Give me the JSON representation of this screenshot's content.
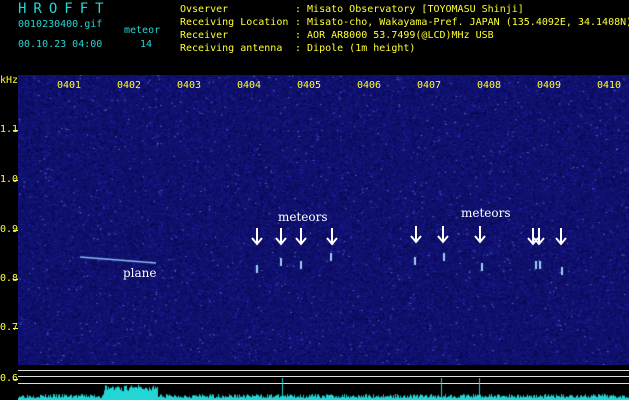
{
  "header": {
    "logo": "HROFFT",
    "filename": "0010230400.gif",
    "type_label": "meteor",
    "datetime": "00.10.23 04:00",
    "count": "14",
    "rows": [
      {
        "label": "Ovserver",
        "value": ": Misato Observatory [TOYOMASU Shinji]"
      },
      {
        "label": "Receiving Location",
        "value": ": Misato-cho, Wakayama-Pref. JAPAN (135.4092E, 34.1408N)"
      },
      {
        "label": "Receiver",
        "value": ": AOR AR8000 53.7499(@LCD)MHz USB"
      },
      {
        "label": "Receiving antenna",
        "value": ": Dipole (1m height)"
      }
    ]
  },
  "axis": {
    "unit": "kHz",
    "y_labels": [
      "1.1",
      "1.0",
      "0.9",
      "0.8",
      "0.7",
      "0.6"
    ],
    "time_labels": [
      "0401",
      "0402",
      "0403",
      "0404",
      "0405",
      "0406",
      "0407",
      "0408",
      "0409",
      "0410"
    ]
  },
  "annotations": {
    "meteors_left": "meteors",
    "meteors_right": "meteors",
    "plane": "plane"
  },
  "colors": {
    "background": "#10106e",
    "text": "#ffff33",
    "logo": "#22d6d6",
    "signal": "#8fd8ff"
  }
}
